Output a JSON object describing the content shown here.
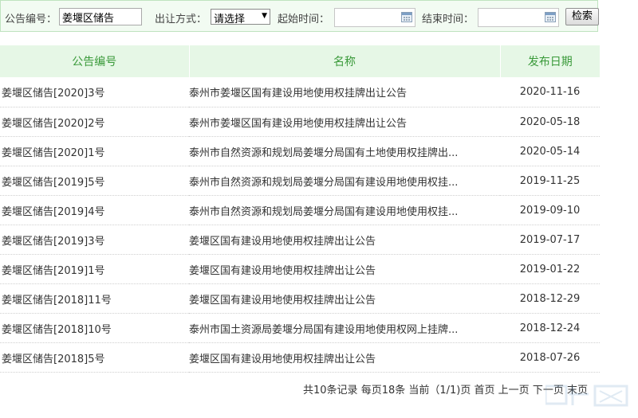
{
  "search": {
    "notice_no_label": "公告编号：",
    "notice_no_value": "姜堰区储告",
    "method_label": "出让方式：",
    "method_selected": "请选择",
    "start_label": "起始时间：",
    "end_label": "结束时间：",
    "search_button": "检索"
  },
  "table": {
    "headers": [
      "公告编号",
      "名称",
      "发布日期"
    ],
    "rows": [
      {
        "no": "姜堰区储告[2020]3号",
        "name": "泰州市姜堰区国有建设用地使用权挂牌出让公告",
        "date": "2020-11-16"
      },
      {
        "no": "姜堰区储告[2020]2号",
        "name": "泰州市姜堰区国有建设用地使用权挂牌出让公告",
        "date": "2020-05-18"
      },
      {
        "no": "姜堰区储告[2020]1号",
        "name": "泰州市自然资源和规划局姜堰分局国有土地使用权挂牌出...",
        "date": "2020-05-14"
      },
      {
        "no": "姜堰区储告[2019]5号",
        "name": "泰州市自然资源和规划局姜堰分局国有建设用地使用权挂...",
        "date": "2019-11-25"
      },
      {
        "no": "姜堰区储告[2019]4号",
        "name": "泰州市自然资源和规划局姜堰分局国有建设用地使用权挂...",
        "date": "2019-09-10"
      },
      {
        "no": "姜堰区储告[2019]3号",
        "name": "姜堰区国有建设用地使用权挂牌出让公告",
        "date": "2019-07-17"
      },
      {
        "no": "姜堰区储告[2019]1号",
        "name": "姜堰区国有建设用地使用权挂牌出让公告",
        "date": "2019-01-22"
      },
      {
        "no": "姜堰区储告[2018]11号",
        "name": "姜堰区国有建设用地使用权挂牌出让公告",
        "date": "2018-12-29"
      },
      {
        "no": "姜堰区储告[2018]10号",
        "name": "泰州市国土资源局姜堰分局国有建设用地使用权网上挂牌...",
        "date": "2018-12-24"
      },
      {
        "no": "姜堰区储告[2018]5号",
        "name": "姜堰区国有建设用地使用权挂牌出让公告",
        "date": "2018-07-26"
      }
    ]
  },
  "pager": {
    "total": "共10条记录",
    "per_page": "每页18条",
    "current": "当前（1/1)页",
    "first": "首页",
    "prev": "上一页",
    "next": "下一页",
    "last": "末页"
  },
  "colors": {
    "header_bg": "#e6f7e6",
    "header_text": "#3a9a3a",
    "search_bg": "#f2fbf2"
  },
  "icons": [
    "calendar-icon",
    "dropdown-arrow-icon"
  ]
}
